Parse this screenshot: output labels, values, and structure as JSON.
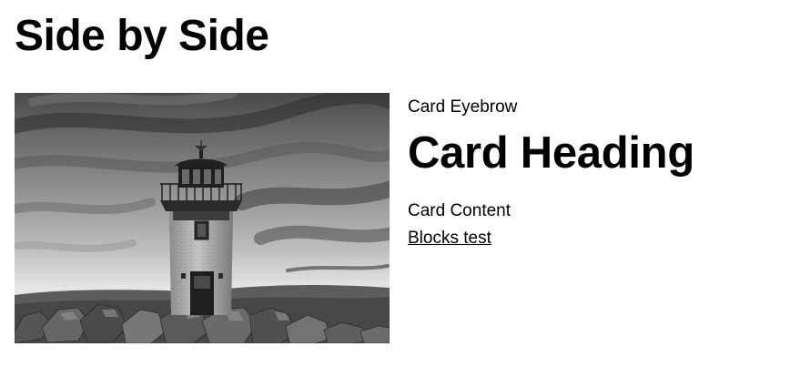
{
  "page": {
    "title": "Side by Side"
  },
  "card": {
    "eyebrow": "Card Eyebrow",
    "heading": "Card Heading",
    "content": "Card Content",
    "link_label": "Blocks test",
    "image_alt": "Lighthouse"
  }
}
